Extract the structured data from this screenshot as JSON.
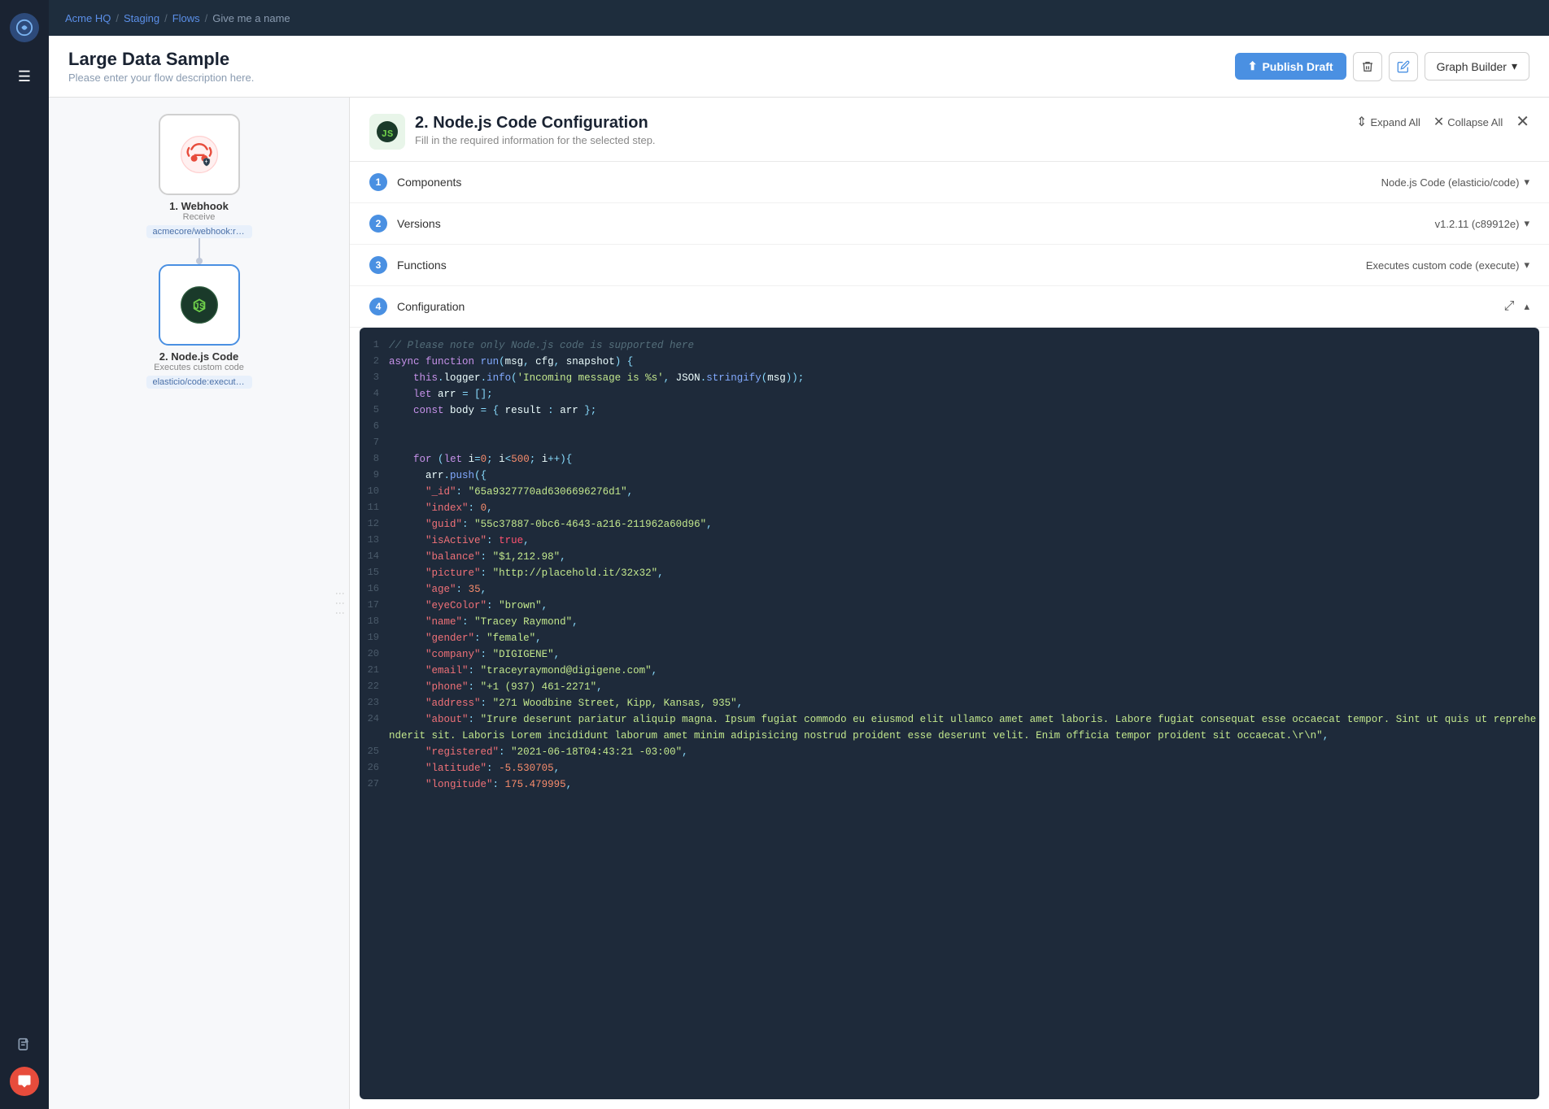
{
  "sidebar": {
    "logo_label": "Logo",
    "items": [
      {
        "name": "menu-icon",
        "label": "Menu",
        "icon": "☰",
        "active": true
      },
      {
        "name": "document-icon",
        "label": "Documents",
        "icon": "📄",
        "active": false
      }
    ],
    "bottom_items": [
      {
        "name": "chat-icon",
        "label": "Chat",
        "icon": "💬",
        "active": false
      }
    ]
  },
  "breadcrumb": {
    "items": [
      "Acme HQ",
      "Staging",
      "Flows",
      "Give me a name"
    ]
  },
  "page": {
    "title": "Large Data Sample",
    "description": "Please enter your flow description here."
  },
  "toolbar": {
    "publish_label": "Publish Draft",
    "delete_tooltip": "Delete",
    "edit_tooltip": "Edit",
    "graph_builder_label": "Graph Builder"
  },
  "flow_canvas": {
    "nodes": [
      {
        "id": "webhook",
        "number": "1",
        "title": "1. Webhook",
        "subtitle": "Receive",
        "badge": "acmecore/webhook:recei..."
      },
      {
        "id": "nodejs",
        "number": "2",
        "title": "2. Node.js Code",
        "subtitle": "Executes custom code",
        "badge": "elasticio/code:execute@..."
      }
    ]
  },
  "config_panel": {
    "title": "2. Node.js Code Configuration",
    "subtitle": "Fill in the required information for the selected step.",
    "expand_all_label": "Expand All",
    "collapse_all_label": "Collapse All",
    "sections": [
      {
        "num": "1",
        "label": "Components",
        "value": "Node.js Code (elasticio/code)"
      },
      {
        "num": "2",
        "label": "Versions",
        "value": "v1.2.11 (c89912e)"
      },
      {
        "num": "3",
        "label": "Functions",
        "value": "Executes custom code (execute)"
      },
      {
        "num": "4",
        "label": "Configuration",
        "value": ""
      }
    ],
    "code": {
      "comment": "// Please note only Node.js code is supported here",
      "lines": [
        "// Please note only Node.js code is supported here",
        "async function run(msg, cfg, snapshot) {",
        "    this.logger.info('Incoming message is %s', JSON.stringify(msg));",
        "    let arr = [];",
        "    const body = { result : arr };",
        "",
        "",
        "    for (let i=0; i<500; i++){",
        "      arr.push({",
        "      \"_id\": \"65a9327770ad6306696276d1\",",
        "      \"index\": 0,",
        "      \"guid\": \"55c37887-0bc6-4643-a216-211962a60d96\",",
        "      \"isActive\": true,",
        "      \"balance\": \"$1,212.98\",",
        "      \"picture\": \"http://placehold.it/32x32\",",
        "      \"age\": 35,",
        "      \"eyeColor\": \"brown\",",
        "      \"name\": \"Tracey Raymond\",",
        "      \"gender\": \"female\",",
        "      \"company\": \"DIGIGENE\",",
        "      \"email\": \"traceyraymond@digigene.com\",",
        "      \"phone\": \"+1 (937) 461-2271\",",
        "      \"address\": \"271 Woodbine Street, Kipp, Kansas, 935\",",
        "      \"about\": \"Irure deserunt pariatur aliquip magna. Ipsum fugiat commodo eu eiusmod elit ullamco amet amet laboris. Labore fugiat consequat esse occaecat tempor. Sint ut quis ut reprehenderit sit. Laboris Lorem incididunt laborum amet minim adipisicing nostrud proident esse deserunt velit. Enim officia tempor proident sit occaecat.\\r\\n\",",
        "      \"registered\": \"2021-06-18T04:43:21 -03:00\",",
        "      \"latitude\": -5.530705,",
        "      \"longitude\": 175.479995,"
      ]
    }
  }
}
